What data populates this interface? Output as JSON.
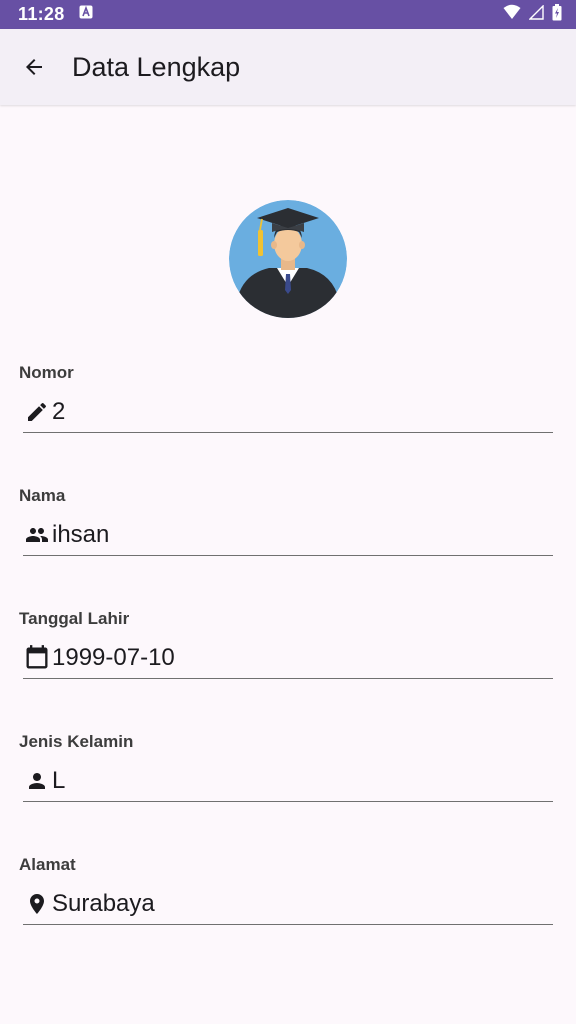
{
  "status_bar": {
    "time": "11:28",
    "icons": [
      "notification-a-icon",
      "wifi-icon",
      "signal-icon",
      "battery-charging-icon"
    ]
  },
  "app_bar": {
    "title": "Data Lengkap",
    "back_icon": "arrow-back-icon"
  },
  "avatar": {
    "icon": "graduate-avatar"
  },
  "fields": [
    {
      "label": "Nomor",
      "value": "2",
      "icon": "pencil-icon"
    },
    {
      "label": "Nama",
      "value": "ihsan",
      "icon": "people-icon"
    },
    {
      "label": "Tanggal Lahir",
      "value": "1999-07-10",
      "icon": "calendar-icon"
    },
    {
      "label": "Jenis Kelamin",
      "value": "L",
      "icon": "person-icon"
    },
    {
      "label": "Alamat",
      "value": "Surabaya",
      "icon": "location-pin-icon"
    }
  ],
  "colors": {
    "status_bar": "#6750a4",
    "app_bar": "#f3eff6",
    "background": "#fdf8fc",
    "avatar_bg": "#6aaee0"
  }
}
